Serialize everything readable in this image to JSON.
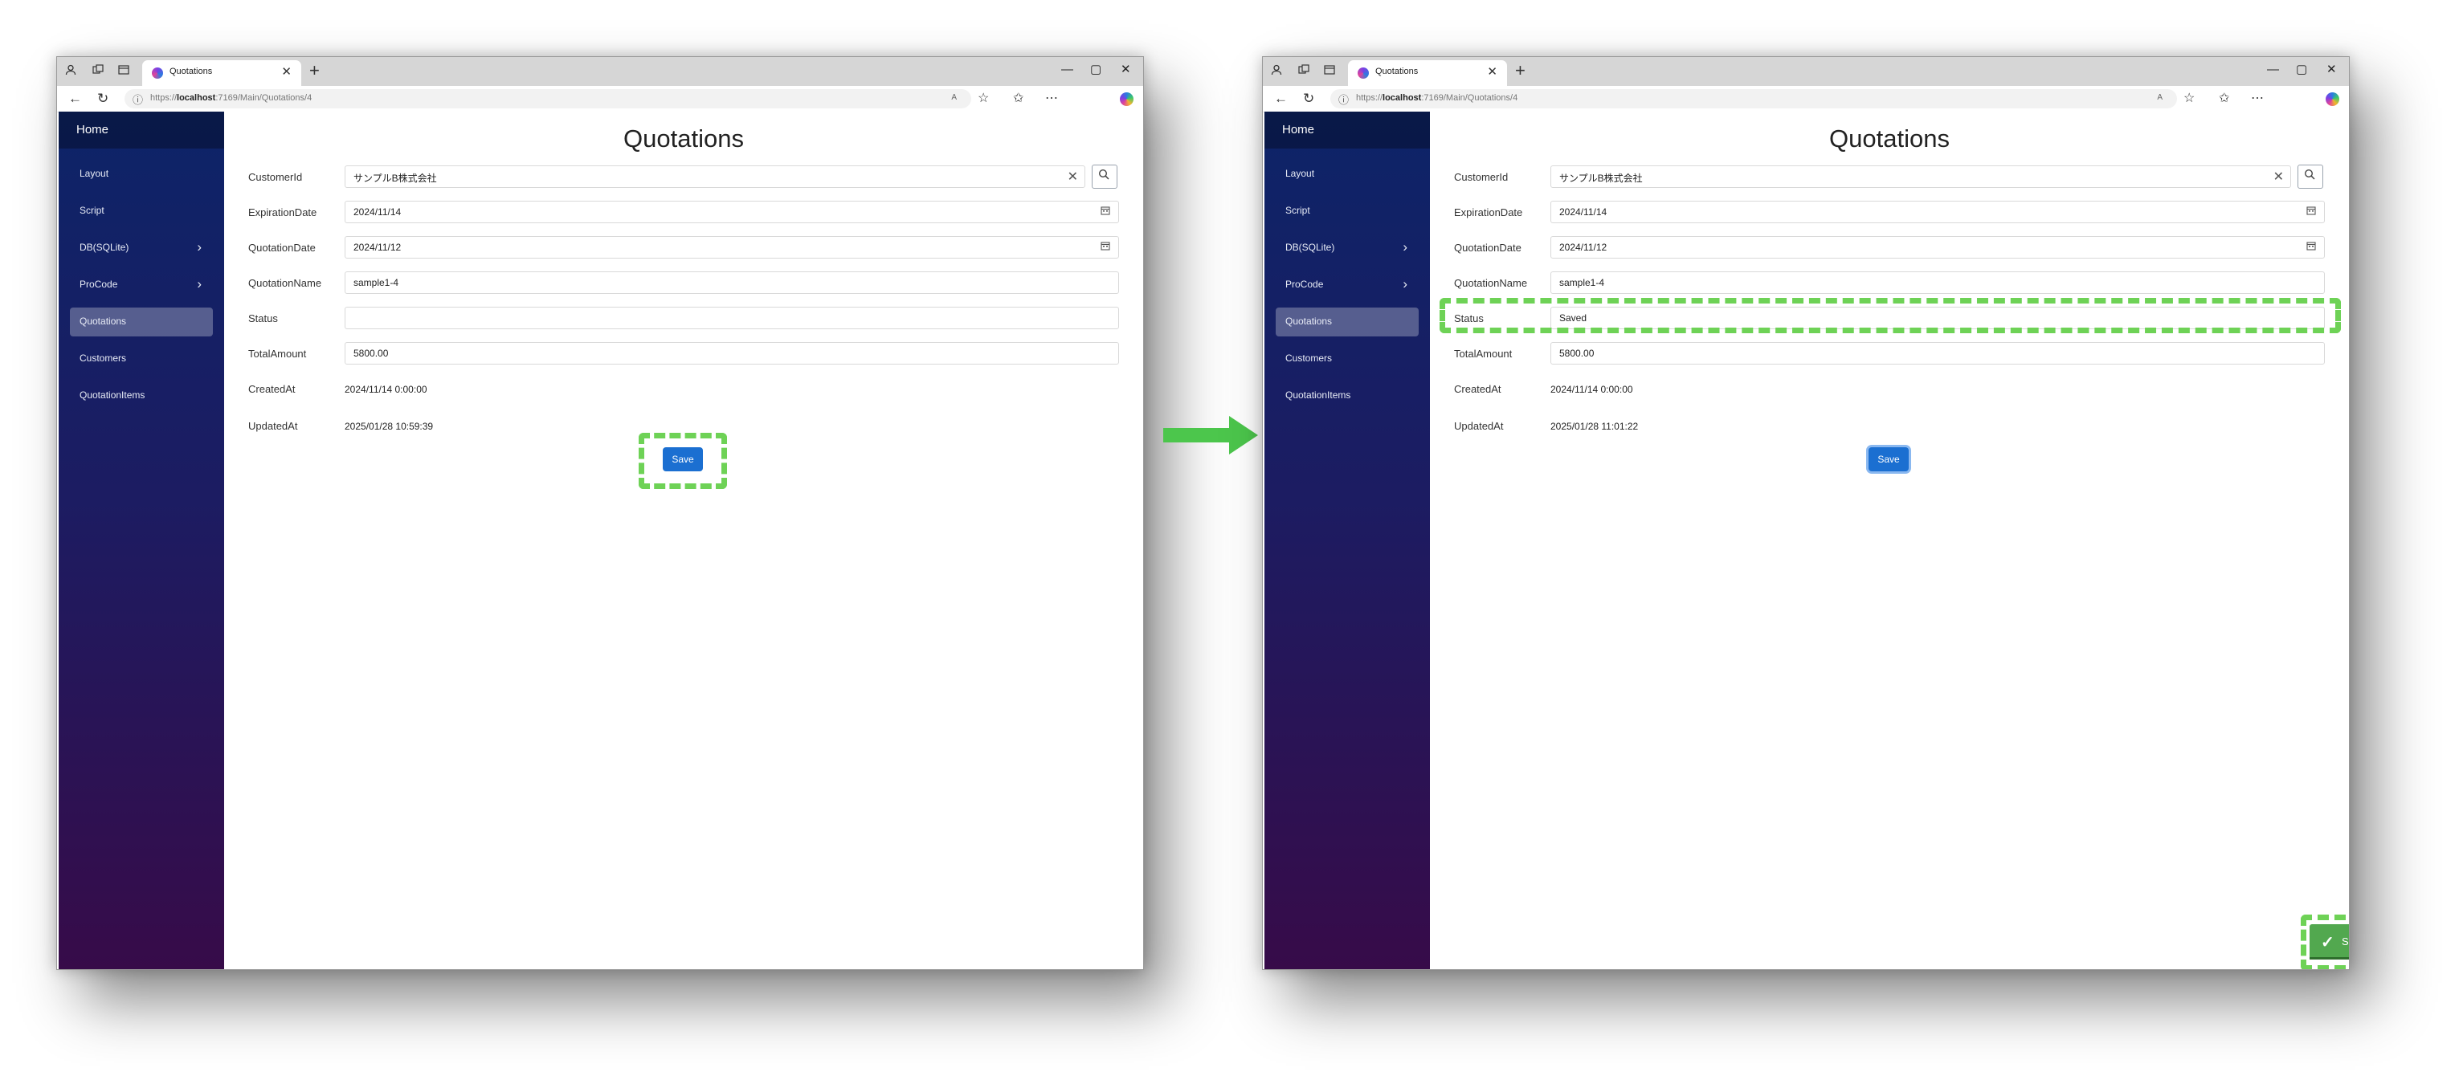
{
  "colors": {
    "sidebar_top": "#0d2468",
    "sidebar_bottom": "#370b49",
    "primary_button": "#1b6fd1",
    "toast_success": "#52a84f",
    "highlight": "#6ed256"
  },
  "browser": {
    "tab_title": "Quotations",
    "url_prefix": "https://",
    "url_host": "localhost",
    "url_path": ":7169/Main/Quotations/4",
    "zoom": "A",
    "icons": [
      "profile-icon",
      "workspaces-icon",
      "tab-actions-icon",
      "back-icon",
      "refresh-icon",
      "site-info-icon",
      "favorites-star-icon",
      "collections-icon",
      "more-icon",
      "copilot-icon"
    ]
  },
  "sidebar": {
    "home": "Home",
    "items": [
      {
        "label": "Layout",
        "chevron": false
      },
      {
        "label": "Script",
        "chevron": false
      },
      {
        "label": "DB(SQLite)",
        "chevron": true
      },
      {
        "label": "ProCode",
        "chevron": true
      },
      {
        "label": "Quotations",
        "chevron": false,
        "active": true
      },
      {
        "label": "Customers",
        "chevron": false
      },
      {
        "label": "QuotationItems",
        "chevron": false
      }
    ]
  },
  "form": {
    "title": "Quotations",
    "labels": {
      "customer_id": "CustomerId",
      "expiration_date": "ExpirationDate",
      "quotation_date": "QuotationDate",
      "quotation_name": "QuotationName",
      "status": "Status",
      "total_amount": "TotalAmount",
      "created_at": "CreatedAt",
      "updated_at": "UpdatedAt"
    },
    "save_label": "Save"
  },
  "before": {
    "customer_id": "サンプルB株式会社",
    "expiration_date": "2024/11/14",
    "quotation_date": "2024/11/12",
    "quotation_name": "sample1-4",
    "status": "",
    "total_amount": "5800.00",
    "created_at": "2024/11/14 0:00:00",
    "updated_at": "2025/01/28 10:59:39"
  },
  "after": {
    "customer_id": "サンプルB株式会社",
    "expiration_date": "2024/11/14",
    "quotation_date": "2024/11/12",
    "quotation_name": "sample1-4",
    "status": "Saved",
    "total_amount": "5800.00",
    "created_at": "2024/11/14 0:00:00",
    "updated_at": "2025/01/28 11:01:22"
  },
  "toast": {
    "message": "Success",
    "progress": 0.2
  }
}
